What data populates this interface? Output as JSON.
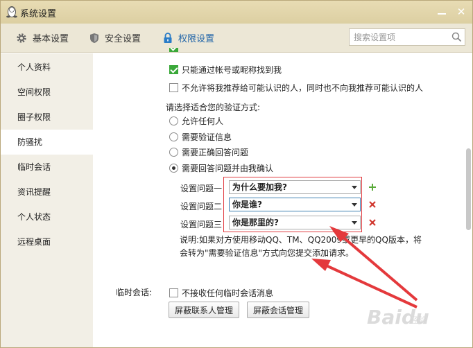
{
  "window": {
    "title": "系统设置",
    "accent": "#2165a8",
    "titlebar_color": "#e3d7ab"
  },
  "tabs": [
    {
      "label": "基本设置",
      "icon": "gear-icon"
    },
    {
      "label": "安全设置",
      "icon": "shield-icon"
    },
    {
      "label": "权限设置",
      "icon": "lock-icon",
      "active": true
    }
  ],
  "search": {
    "placeholder": "搜索设置项"
  },
  "sidebar": {
    "items": [
      {
        "label": "个人资料"
      },
      {
        "label": "空间权限"
      },
      {
        "label": "圈子权限"
      },
      {
        "label": "防骚扰",
        "active": true
      },
      {
        "label": "临时会话"
      },
      {
        "label": "资讯提醒"
      },
      {
        "label": "个人状态"
      },
      {
        "label": "远程桌面"
      }
    ]
  },
  "main": {
    "options": [
      {
        "label": "只能通过帐号或昵称找到我",
        "checked": true
      },
      {
        "label": "不允许将我推荐给可能认识的人，同时也不向我推荐可能认识的人",
        "checked": false
      }
    ],
    "verify_title": "请选择适合您的验证方式:",
    "verify_options": [
      {
        "label": "允许任何人",
        "selected": false
      },
      {
        "label": "需要验证信息",
        "selected": false
      },
      {
        "label": "需要正确回答问题",
        "selected": false
      },
      {
        "label": "需要回答问题并由我确认",
        "selected": true
      }
    ],
    "questions": [
      {
        "label": "设置问题一",
        "value": "为什么要加我?",
        "action": "add"
      },
      {
        "label": "设置问题二",
        "value": "你是谁?",
        "action": "delete"
      },
      {
        "label": "设置问题三",
        "value": "你是那里的?",
        "action": "delete"
      }
    ],
    "note": "说明:如果对方使用移动QQ、TM、QQ2009或更早的QQ版本，将会转为\"需要验证信息\"方式向您提交添加请求。",
    "temp_chat_label": "临时会话:",
    "temp_chat_option": {
      "label": "不接收任何临时会话消息",
      "checked": false
    },
    "buttons": {
      "block_contacts": "屏蔽联系人管理",
      "block_sessions": "屏蔽会话管理"
    }
  },
  "watermark": {
    "brand": "Baidu",
    "sub": "经验"
  }
}
